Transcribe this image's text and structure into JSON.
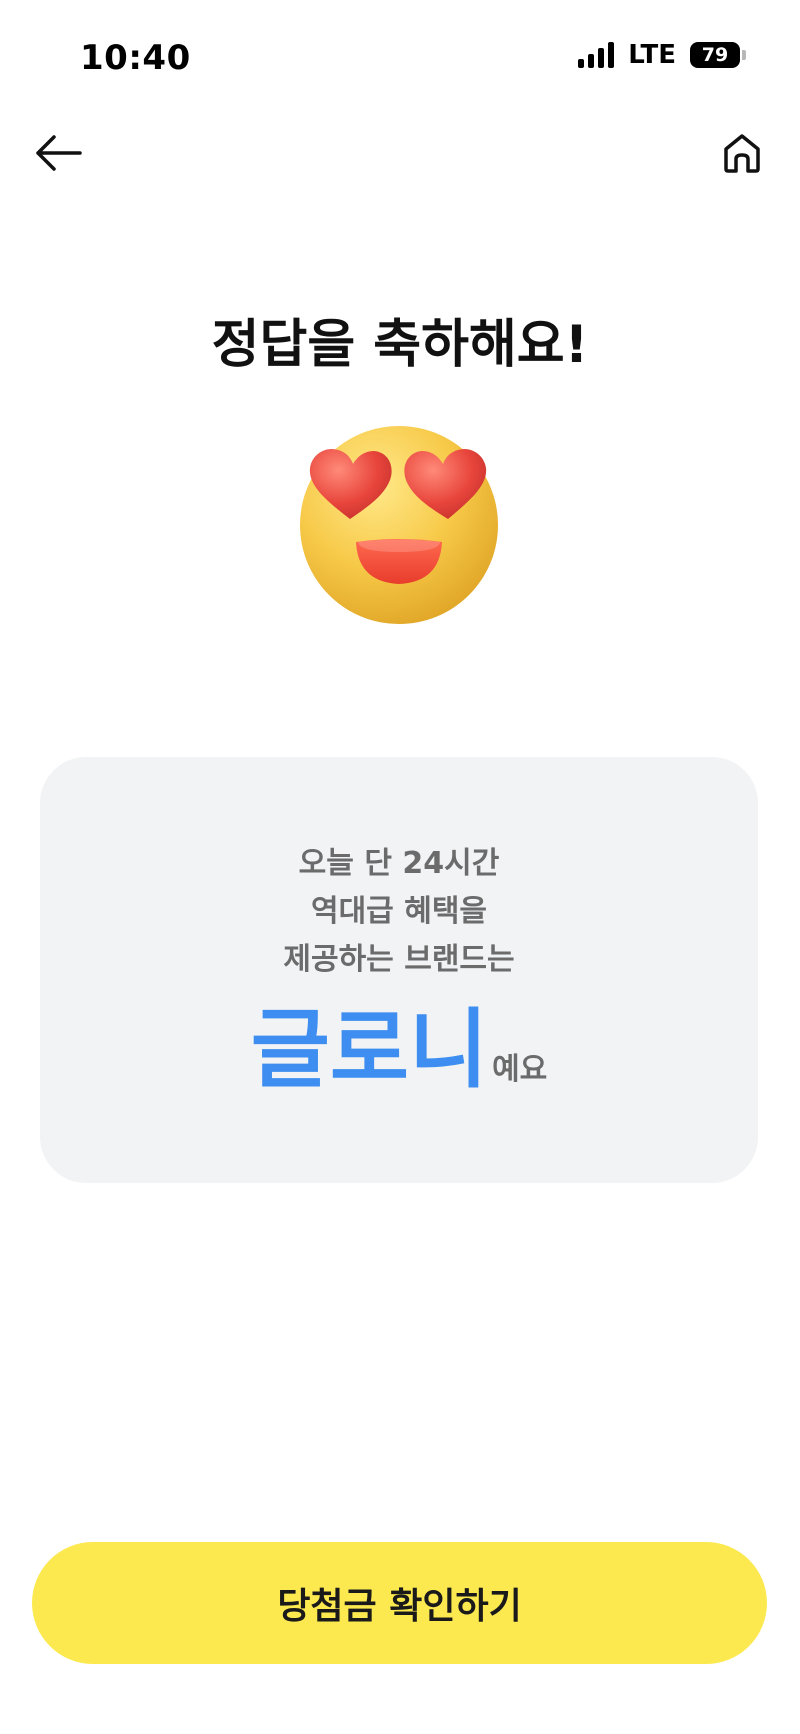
{
  "status_bar": {
    "time": "10:40",
    "network": "LTE",
    "battery": "79"
  },
  "nav": {
    "back_icon": "arrow-left-icon",
    "home_icon": "home-icon"
  },
  "title": "정답을 축하해요!",
  "emoji": {
    "icon": "heart-eyes-emoji",
    "face_color": "#f7c948",
    "heart_color": "#e8453c"
  },
  "card": {
    "lines": [
      "오늘 단 24시간",
      "역대급 혜택을",
      "제공하는 브랜드는"
    ],
    "answer": "글로니",
    "answer_suffix": "예요",
    "answer_color": "#3d8ef0",
    "background": "#f2f3f5"
  },
  "cta": {
    "label": "당첨금 확인하기",
    "color": "#fce94f"
  }
}
